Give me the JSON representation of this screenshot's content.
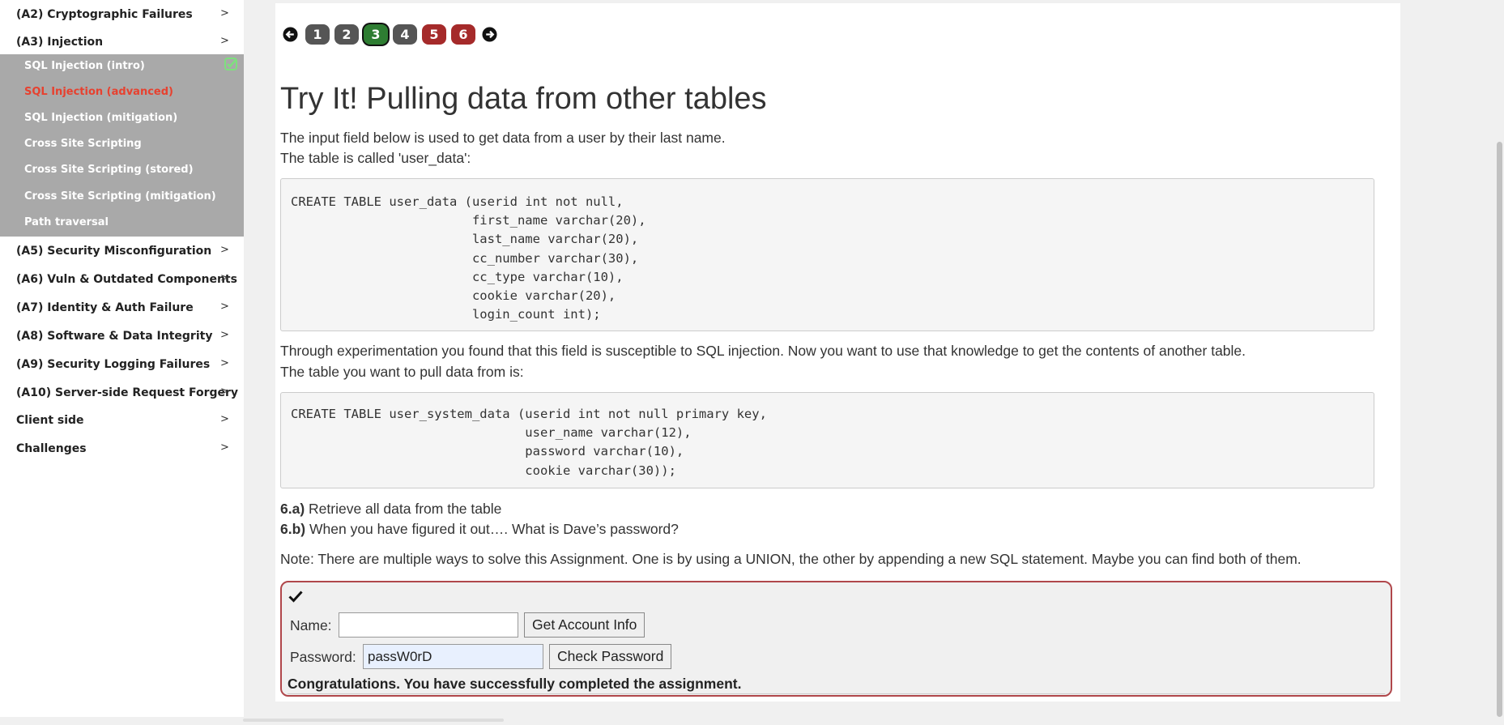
{
  "sidebar": {
    "categories": [
      {
        "label": "(A2) Cryptographic Failures",
        "chevron": ">"
      },
      {
        "label": "(A3) Injection",
        "chevron": ">"
      },
      {
        "label": "(A5) Security Misconfiguration",
        "chevron": ">"
      },
      {
        "label": "(A6) Vuln & Outdated Components",
        "chevron": ">"
      },
      {
        "label": "(A7) Identity & Auth Failure",
        "chevron": ">"
      },
      {
        "label": "(A8) Software & Data Integrity",
        "chevron": ">"
      },
      {
        "label": "(A9) Security Logging Failures",
        "chevron": ">"
      },
      {
        "label": "(A10) Server-side Request Forgery",
        "chevron": ">"
      },
      {
        "label": "Client side",
        "chevron": ">"
      },
      {
        "label": "Challenges",
        "chevron": ">"
      }
    ],
    "lessons": [
      {
        "label": "SQL Injection (intro)",
        "completed": true
      },
      {
        "label": "SQL Injection (advanced)",
        "active": true
      },
      {
        "label": "SQL Injection (mitigation)"
      },
      {
        "label": "Cross Site Scripting"
      },
      {
        "label": "Cross Site Scripting (stored)"
      },
      {
        "label": "Cross Site Scripting (mitigation)"
      },
      {
        "label": "Path traversal"
      }
    ]
  },
  "pager": {
    "pages": [
      {
        "label": "1",
        "status": "neutral"
      },
      {
        "label": "2",
        "status": "neutral"
      },
      {
        "label": "3",
        "status": "current-solved"
      },
      {
        "label": "4",
        "status": "neutral"
      },
      {
        "label": "5",
        "status": "unsolved"
      },
      {
        "label": "6",
        "status": "unsolved"
      }
    ],
    "colors": {
      "neutral": "#555555",
      "solved": "#2e7d32",
      "unsolved": "#a52a2a"
    }
  },
  "lesson": {
    "title": "Try It! Pulling data from other tables",
    "intro_1": "The input field below is used to get data from a user by their last name.",
    "intro_2": "The table is called 'user_data':",
    "code_1": [
      "CREATE TABLE user_data (userid int not null,",
      "                        first_name varchar(20),",
      "                        last_name varchar(20),",
      "                        cc_number varchar(30),",
      "                        cc_type varchar(10),",
      "                        cookie varchar(20),",
      "                        login_count int);"
    ],
    "para_1": "Through experimentation you found that this field is susceptible to SQL injection. Now you want to use that knowledge to get the contents of another table.",
    "para_2": "The table you want to pull data from is:",
    "code_2": [
      "CREATE TABLE user_system_data (userid int not null primary key,",
      "                               user_name varchar(12),",
      "                               password varchar(10),",
      "                               cookie varchar(30));"
    ],
    "task_a_label": "6.a)",
    "task_a_text": "Retrieve all data from the table",
    "task_b_label": "6.b)",
    "task_b_text": "When you have figured it out…. What is Dave’s password?",
    "note": "Note: There are multiple ways to solve this Assignment. One is by using a UNION, the other by appending a new SQL statement. Maybe you can find both of them."
  },
  "assignment": {
    "name_label": "Name:",
    "name_value": "",
    "get_button": "Get Account Info",
    "password_label": "Password:",
    "password_value": "passW0rD",
    "check_button": "Check Password",
    "feedback": "Congratulations. You have successfully completed the assignment.",
    "border_color": "#b0474b"
  }
}
